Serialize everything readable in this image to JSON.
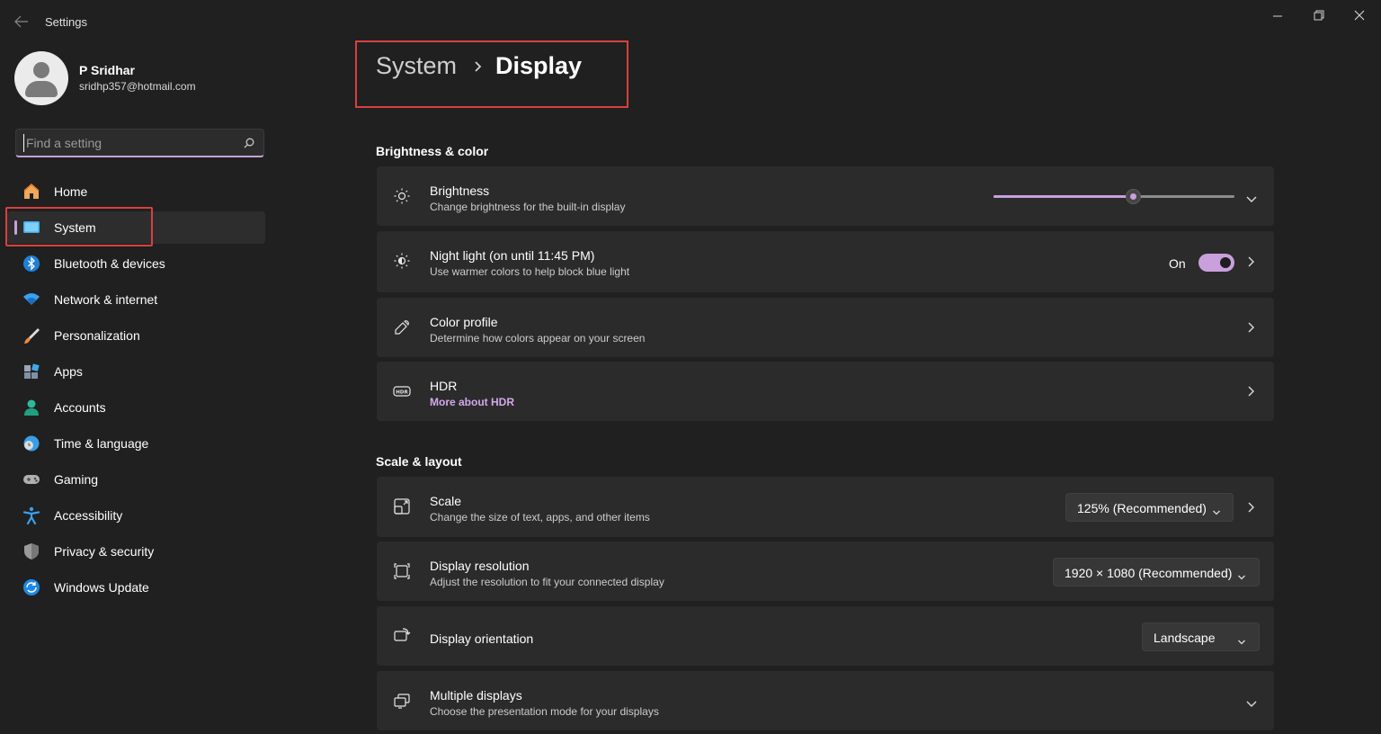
{
  "window": {
    "title": "Settings"
  },
  "user": {
    "name": "P Sridhar",
    "email": "sridhp357@hotmail.com"
  },
  "search": {
    "placeholder": "Find a setting"
  },
  "sidebar": {
    "items": [
      {
        "label": "Home",
        "icon": "home-icon",
        "active": false
      },
      {
        "label": "System",
        "icon": "system-icon",
        "active": true
      },
      {
        "label": "Bluetooth & devices",
        "icon": "bluetooth-icon",
        "active": false
      },
      {
        "label": "Network & internet",
        "icon": "wifi-icon",
        "active": false
      },
      {
        "label": "Personalization",
        "icon": "brush-icon",
        "active": false
      },
      {
        "label": "Apps",
        "icon": "apps-icon",
        "active": false
      },
      {
        "label": "Accounts",
        "icon": "accounts-icon",
        "active": false
      },
      {
        "label": "Time & language",
        "icon": "globe-clock-icon",
        "active": false
      },
      {
        "label": "Gaming",
        "icon": "gamepad-icon",
        "active": false
      },
      {
        "label": "Accessibility",
        "icon": "accessibility-icon",
        "active": false
      },
      {
        "label": "Privacy & security",
        "icon": "shield-icon",
        "active": false
      },
      {
        "label": "Windows Update",
        "icon": "update-icon",
        "active": false
      }
    ]
  },
  "breadcrumb": {
    "parent": "System",
    "current": "Display"
  },
  "sections": {
    "brightness_color": {
      "title": "Brightness & color",
      "brightness": {
        "title": "Brightness",
        "subtitle": "Change brightness for the built-in display",
        "level": 0.58
      },
      "night_light": {
        "title": "Night light (on until 11:45 PM)",
        "subtitle": "Use warmer colors to help block blue light",
        "state_label": "On",
        "enabled": true
      },
      "color_profile": {
        "title": "Color profile",
        "subtitle": "Determine how colors appear on your screen"
      },
      "hdr": {
        "title": "HDR",
        "link": "More about HDR"
      }
    },
    "scale_layout": {
      "title": "Scale & layout",
      "scale": {
        "title": "Scale",
        "subtitle": "Change the size of text, apps, and other items",
        "value": "125% (Recommended)"
      },
      "resolution": {
        "title": "Display resolution",
        "subtitle": "Adjust the resolution to fit your connected display",
        "value": "1920 × 1080 (Recommended)"
      },
      "orientation": {
        "title": "Display orientation",
        "value": "Landscape"
      },
      "multiple": {
        "title": "Multiple displays",
        "subtitle": "Choose the presentation mode for your displays"
      }
    }
  },
  "colors": {
    "accent": "#c9a0dc",
    "highlight_box": "#d8403f",
    "background": "#202020",
    "card": "#2b2b2b"
  }
}
